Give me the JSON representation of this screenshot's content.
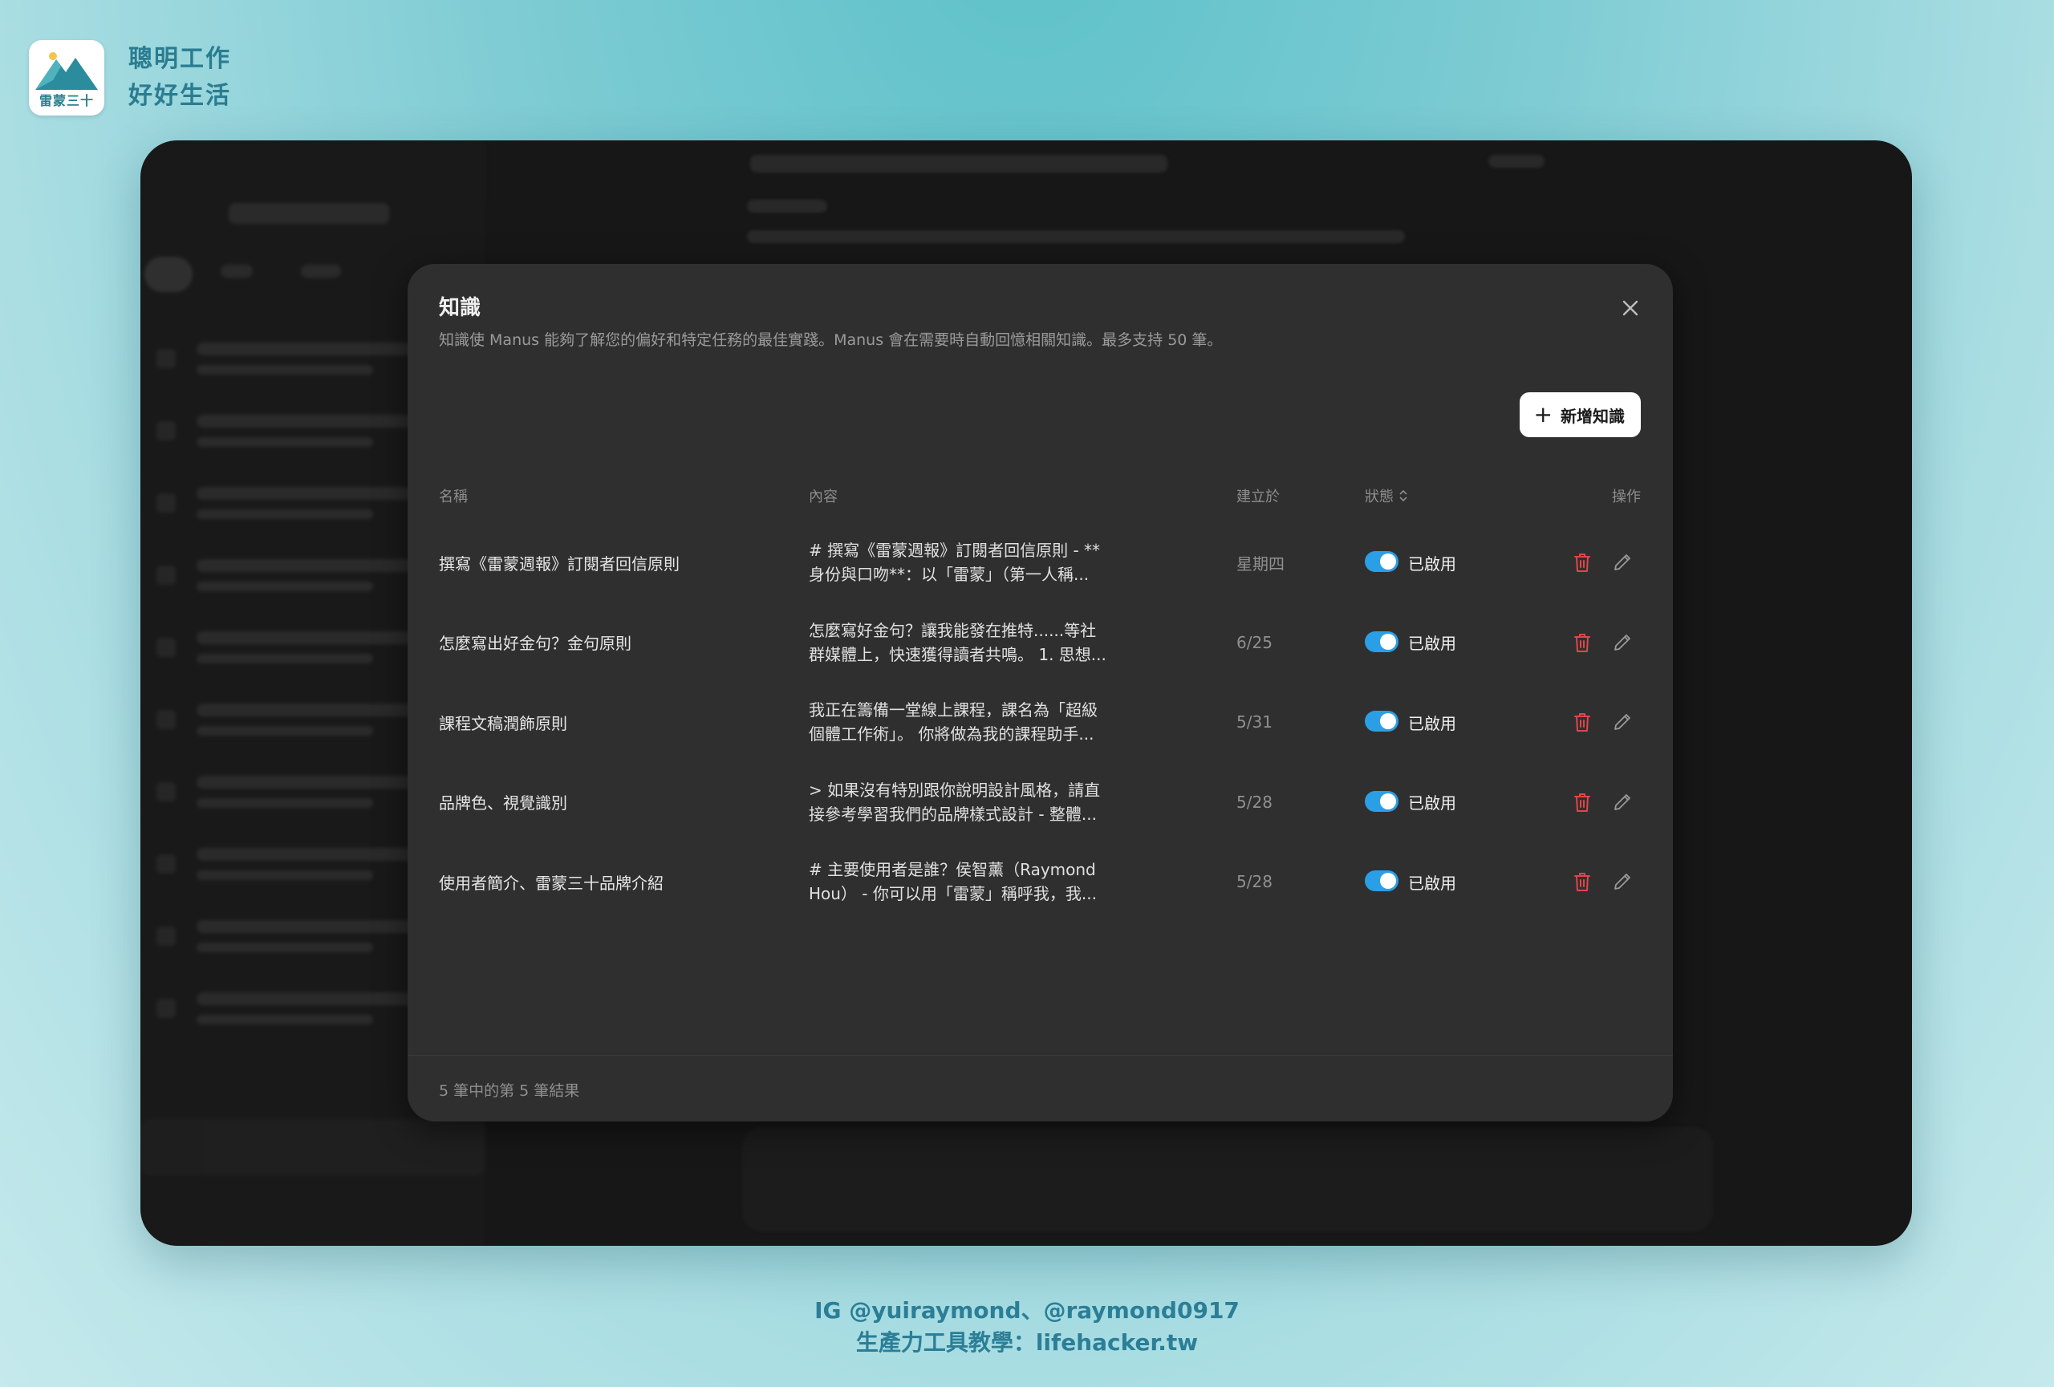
{
  "brand": {
    "logo_text": "雷蒙三十",
    "line1": "聰明工作",
    "line2": "好好生活"
  },
  "modal": {
    "title": "知識",
    "subtitle": "知識使 Manus 能夠了解您的偏好和特定任務的最佳實踐。Manus 會在需要時自動回憶相關知識。最多支持 50 筆。",
    "add_button_label": "新增知識",
    "columns": {
      "name": "名稱",
      "content": "內容",
      "created": "建立於",
      "status": "狀態",
      "actions": "操作"
    },
    "rows": [
      {
        "name": "撰寫《雷蒙週報》訂閱者回信原則",
        "content_line1": "# 撰寫《雷蒙週報》訂閱者回信原則 - **",
        "content_line2": "身份與口吻**：以「雷蒙」（第一人稱...",
        "date": "星期四",
        "status": "已啟用"
      },
      {
        "name": "怎麼寫出好金句？金句原則",
        "content_line1": "怎麼寫好金句？讓我能發在推特......等社",
        "content_line2": "群媒體上，快速獲得讀者共鳴。 1. 思想...",
        "date": "6/25",
        "status": "已啟用"
      },
      {
        "name": "課程文稿潤飾原則",
        "content_line1": "我正在籌備一堂線上課程，課名為「超級",
        "content_line2": "個體工作術」。 你將做為我的課程助手...",
        "date": "5/31",
        "status": "已啟用"
      },
      {
        "name": "品牌色、視覺識別",
        "content_line1": "> 如果沒有特別跟你說明設計風格，請直",
        "content_line2": "接參考學習我們的品牌樣式設計 - 整體...",
        "date": "5/28",
        "status": "已啟用"
      },
      {
        "name": "使用者簡介、雷蒙三十品牌介紹",
        "content_line1": "# 主要使用者是誰？侯智薰（Raymond",
        "content_line2": "Hou） - 你可以用「雷蒙」稱呼我，我...",
        "date": "5/28",
        "status": "已啟用"
      }
    ],
    "footer": "5 筆中的第 5 筆結果"
  },
  "credits": {
    "line1": "IG @yuiraymond、@raymond0917",
    "line2": "生產力工具教學：lifehacker.tw"
  },
  "colors": {
    "toggle_on": "#2b9fe6",
    "delete_icon": "#e0464b",
    "modal_bg": "#2f2f2f",
    "brand_text": "#2a7c90"
  }
}
